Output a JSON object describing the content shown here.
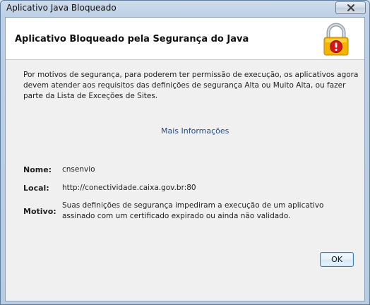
{
  "window": {
    "title": "Aplicativo Java Bloqueado"
  },
  "header": {
    "title": "Aplicativo Bloqueado pela Segurança do Java"
  },
  "body": {
    "message": "Por motivos de segurança, para poderem ter permissão de execução, os aplicativos agora devem atender aos requisitos das definições de segurança Alta ou Muito Alta, ou fazer parte da Lista de Exceções de Sites.",
    "more_info": "Mais Informações"
  },
  "fields": {
    "nome_label": "Nome:",
    "nome_value": "cnsenvio",
    "local_label": "Local:",
    "local_value": "http://conectividade.caixa.gov.br:80",
    "motivo_label": "Motivo:",
    "motivo_value": "Suas definições de segurança impediram a execução de um aplicativo assinado com um certificado expirado ou ainda não validado."
  },
  "buttons": {
    "ok": "OK"
  },
  "colors": {
    "link": "#1f4b87",
    "lock_body": "#f5b400",
    "alert_red": "#d21818"
  },
  "icons": {
    "close": "close-icon",
    "lock": "lock-warning-icon"
  }
}
